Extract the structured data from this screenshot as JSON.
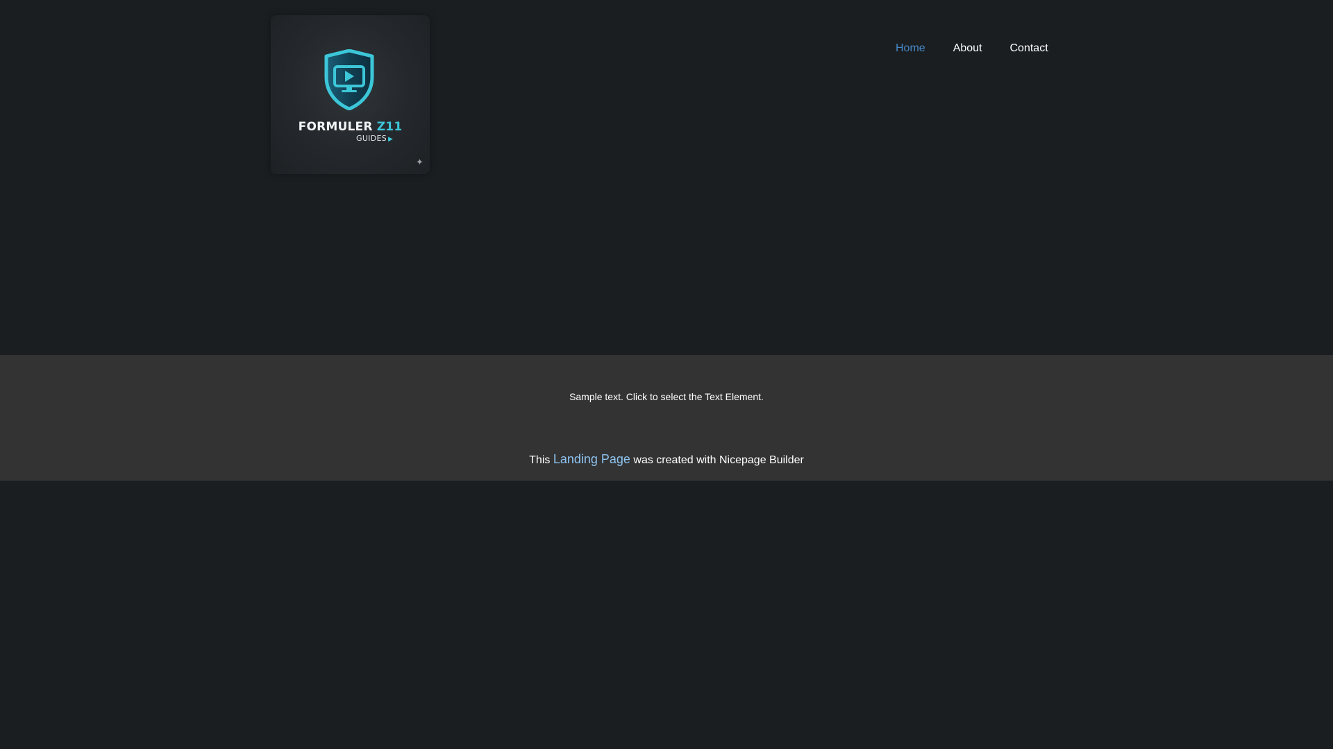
{
  "logo": {
    "brand_main": "FORMULER",
    "brand_accent": "Z11",
    "sub": "GUIDES",
    "icon": "shield-tv-play-icon"
  },
  "nav": {
    "items": [
      {
        "label": "Home",
        "active": true
      },
      {
        "label": "About",
        "active": false
      },
      {
        "label": "Contact",
        "active": false
      }
    ]
  },
  "content": {
    "sample_text": "Sample text. Click to select the Text Element."
  },
  "footer": {
    "prefix": "This",
    "link_label": "Landing Page",
    "suffix": "was created with Nicepage Builder"
  },
  "colors": {
    "background": "#1b1e21",
    "footer_band": "#333333",
    "nav_active": "#478ac9",
    "link": "#8dc3f0",
    "logo_accent": "#3cc7d9"
  }
}
